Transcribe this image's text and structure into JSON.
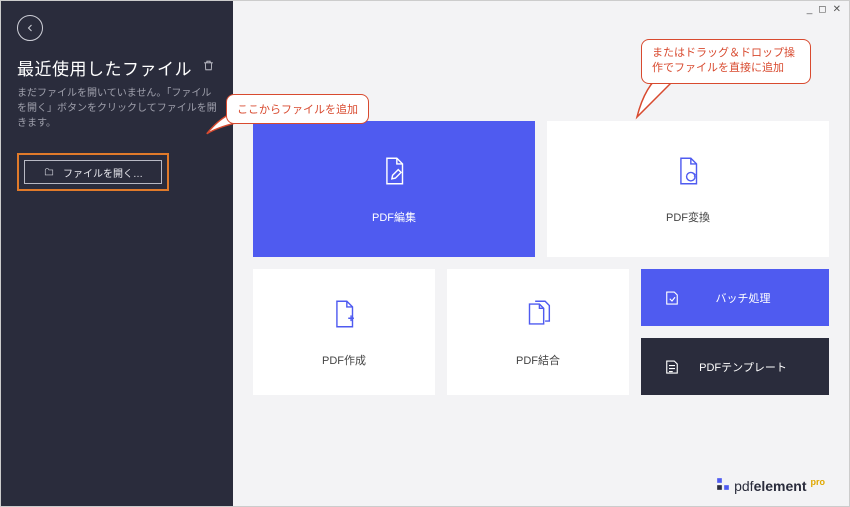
{
  "window": {
    "minimize": "_",
    "maximize": "◻",
    "close": "✕"
  },
  "sidebar": {
    "recent_title": "最近使用したファイル",
    "recent_desc": "まだファイルを開いていません。「ファイルを開く」ボタンをクリックしてファイルを開きます。",
    "open_label": "ファイルを開く…"
  },
  "cards": {
    "edit": "PDF編集",
    "convert": "PDF変換",
    "create": "PDF作成",
    "combine": "PDF結合",
    "batch": "バッチ処理",
    "template": "PDFテンプレート"
  },
  "callouts": {
    "add_here": "ここからファイルを追加",
    "drag_drop": "またはドラッグ＆ドロップ操作でファイルを直接に追加"
  },
  "brand": {
    "name_light": "pdf",
    "name_bold": "element",
    "pro": "pro"
  }
}
